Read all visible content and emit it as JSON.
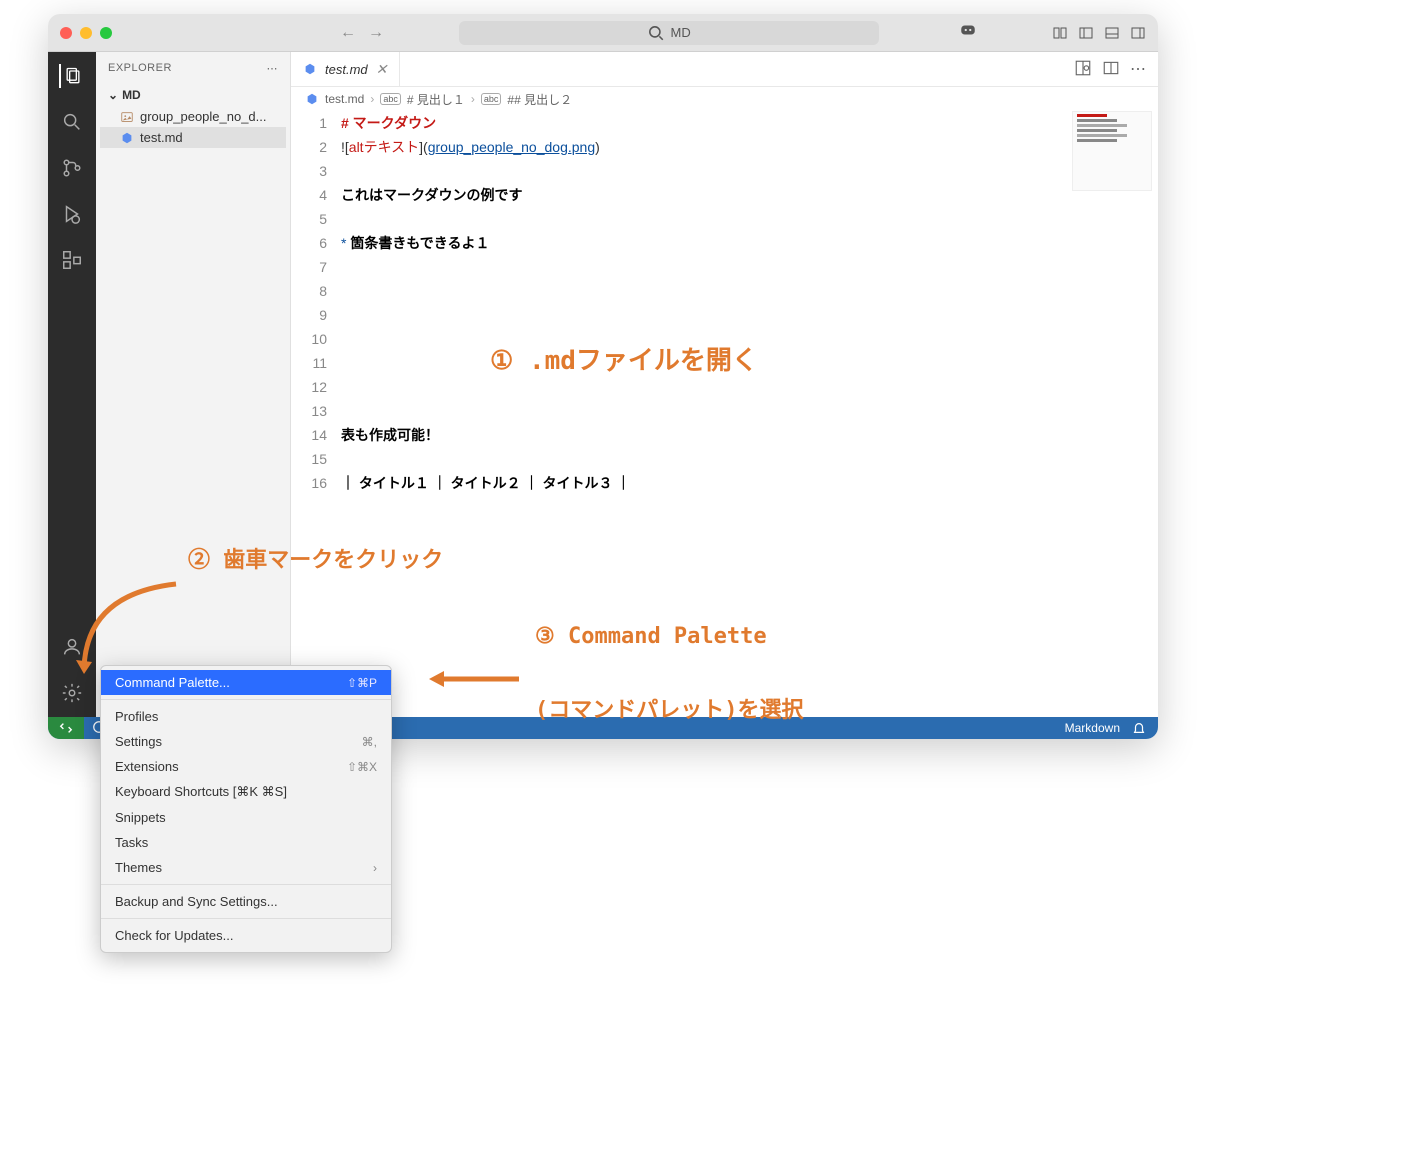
{
  "titlebar": {
    "search_text": "MD"
  },
  "sidebar": {
    "title": "EXPLORER",
    "section": "MD",
    "files": [
      {
        "name": "group_people_no_d..."
      },
      {
        "name": "test.md"
      }
    ]
  },
  "tab": {
    "name": "test.md"
  },
  "breadcrumb": {
    "file": "test.md",
    "h1": "# 見出し１",
    "h2": "## 見出し２"
  },
  "code": {
    "lines": [
      {
        "n": 1,
        "type": "heading",
        "text": "# マークダウン"
      },
      {
        "n": 2,
        "type": "image",
        "prefix": "!",
        "alt": "altテキスト",
        "link": "group_people_no_dog.png"
      },
      {
        "n": 3,
        "type": "blank",
        "text": ""
      },
      {
        "n": 4,
        "type": "text",
        "text": "これはマークダウンの例です"
      },
      {
        "n": 5,
        "type": "blank",
        "text": ""
      },
      {
        "n": 6,
        "type": "bullet",
        "star": "*",
        "text": "箇条書きもできるよ１"
      },
      {
        "n": 7,
        "type": "blank",
        "text": ""
      },
      {
        "n": 8,
        "type": "blank",
        "text": ""
      },
      {
        "n": 9,
        "type": "blank",
        "text": ""
      },
      {
        "n": 10,
        "type": "blank",
        "text": ""
      },
      {
        "n": 11,
        "type": "blank",
        "text": ""
      },
      {
        "n": 12,
        "type": "blank",
        "text": ""
      },
      {
        "n": 13,
        "type": "blank",
        "text": ""
      },
      {
        "n": 14,
        "type": "text",
        "text": "表も作成可能！"
      },
      {
        "n": 15,
        "type": "blank",
        "text": ""
      },
      {
        "n": 16,
        "type": "text",
        "text": "｜ タイトル１ ｜ タイトル２ ｜ タイトル３ ｜"
      }
    ]
  },
  "statusbar": {
    "language": "Markdown"
  },
  "menu": {
    "items": [
      {
        "label": "Command Palette...",
        "shortcut": "⇧⌘P",
        "selected": true
      },
      {
        "sep": true
      },
      {
        "label": "Profiles"
      },
      {
        "label": "Settings",
        "shortcut": "⌘,"
      },
      {
        "label": "Extensions",
        "shortcut": "⇧⌘X"
      },
      {
        "label": "Keyboard Shortcuts [⌘K ⌘S]"
      },
      {
        "label": "Snippets"
      },
      {
        "label": "Tasks"
      },
      {
        "label": "Themes",
        "chevron": true
      },
      {
        "sep": true
      },
      {
        "label": "Backup and Sync Settings..."
      },
      {
        "sep": true
      },
      {
        "label": "Check for Updates..."
      }
    ]
  },
  "annotations": {
    "step1": "① .mdファイルを開く",
    "step2": "② 歯車マークをクリック",
    "step3a": "③ Command Palette",
    "step3b": "(コマンドパレット)を選択"
  }
}
